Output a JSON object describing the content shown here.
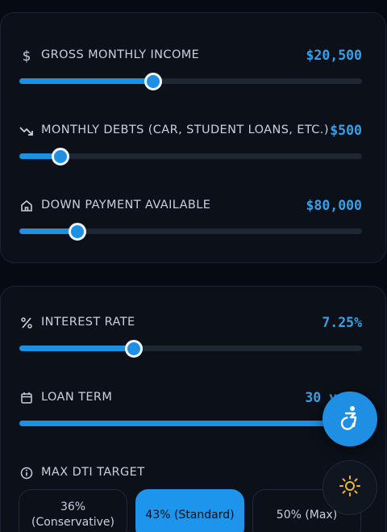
{
  "income_card": {
    "gross_income": {
      "label": "GROSS MONTHLY INCOME",
      "value": "$20,500",
      "icon": "dollar-icon",
      "slider_fraction": 0.39
    },
    "monthly_debts": {
      "label": "MONTHLY DEBTS (CAR, STUDENT LOANS, ETC.)",
      "value": "$500",
      "icon": "trending-down-icon",
      "slider_fraction": 0.12
    },
    "down_payment": {
      "label": "DOWN PAYMENT AVAILABLE",
      "value": "$80,000",
      "icon": "home-icon",
      "slider_fraction": 0.17
    }
  },
  "loan_card": {
    "interest_rate": {
      "label": "INTEREST RATE",
      "value": "7.25%",
      "icon": "percent-icon",
      "slider_fraction": 0.335
    },
    "loan_term": {
      "label": "LOAN TERM",
      "value": "30 ye",
      "icon": "calendar-icon",
      "slider_fraction": 1.0
    },
    "max_dti": {
      "label": "MAX DTI TARGET",
      "icon": "info-icon",
      "options": [
        {
          "line1": "36%",
          "line2": "(Conservative)",
          "active": false
        },
        {
          "line1": "43% (Standard)",
          "line2": "",
          "active": true
        },
        {
          "line1": "50% (Max)",
          "line2": "",
          "active": false
        }
      ]
    }
  },
  "fabs": {
    "accessibility": {
      "icon": "accessibility-icon"
    },
    "theme": {
      "icon": "sun-icon"
    }
  },
  "colors": {
    "accent": "#1e8fe2",
    "value_text": "#3a9fe6",
    "background": "#060a12",
    "card": "#0b1019"
  }
}
